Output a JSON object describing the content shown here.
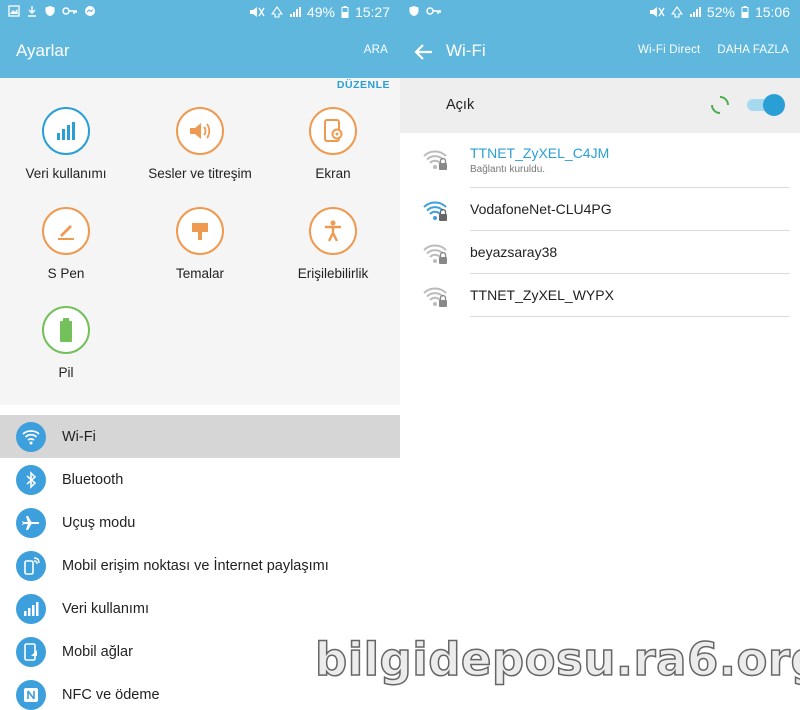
{
  "left_status": {
    "percent": "49%",
    "time": "15:27"
  },
  "right_status": {
    "percent": "52%",
    "time": "15:06"
  },
  "settings": {
    "title": "Ayarlar",
    "search_label": "ARA",
    "edit_label": "DÜZENLE",
    "quick": [
      {
        "label": "Veri kullanımı",
        "icon": "data-usage-icon",
        "color": "#2a9fd6"
      },
      {
        "label": "Sesler ve titreşim",
        "icon": "speaker-icon",
        "color": "#ef9a51"
      },
      {
        "label": "Ekran",
        "icon": "display-settings-icon",
        "color": "#ef9a51"
      },
      {
        "label": "S Pen",
        "icon": "pen-icon",
        "color": "#ef9a51"
      },
      {
        "label": "Temalar",
        "icon": "paint-brush-icon",
        "color": "#ef9a51"
      },
      {
        "label": "Erişilebilirlik",
        "icon": "accessibility-icon",
        "color": "#ef9a51"
      },
      {
        "label": "Pil",
        "icon": "battery-icon",
        "color": "#74c05a"
      }
    ],
    "list": [
      {
        "label": "Wi-Fi",
        "icon": "wifi-icon",
        "selected": true
      },
      {
        "label": "Bluetooth",
        "icon": "bluetooth-icon"
      },
      {
        "label": "Uçuş modu",
        "icon": "airplane-icon"
      },
      {
        "label": "Mobil erişim noktası ve İnternet paylaşımı",
        "icon": "hotspot-icon"
      },
      {
        "label": "Veri kullanımı",
        "icon": "data-usage-icon"
      },
      {
        "label": "Mobil ağlar",
        "icon": "mobile-network-icon"
      },
      {
        "label": "NFC ve ödeme",
        "icon": "nfc-icon"
      }
    ]
  },
  "wifi": {
    "title": "Wi-Fi",
    "wifi_direct_label": "Wi-Fi Direct",
    "more_label": "DAHA FAZLA",
    "toggle_label": "Açık",
    "toggle_on": true,
    "networks": [
      {
        "name": "TTNET_ZyXEL_C4JM",
        "status": "Bağlantı kuruldu.",
        "connected": true,
        "secured": true
      },
      {
        "name": "VodafoneNet-CLU4PG",
        "secured": true
      },
      {
        "name": "beyazsaray38",
        "secured": true
      },
      {
        "name": "TTNET_ZyXEL_WYPX",
        "secured": true
      }
    ]
  },
  "watermark": "bilgideposu.ra6.org",
  "colors": {
    "accent": "#2a9fd6",
    "bar": "#5fb7de",
    "orange": "#ef9a51",
    "green": "#74c05a"
  }
}
